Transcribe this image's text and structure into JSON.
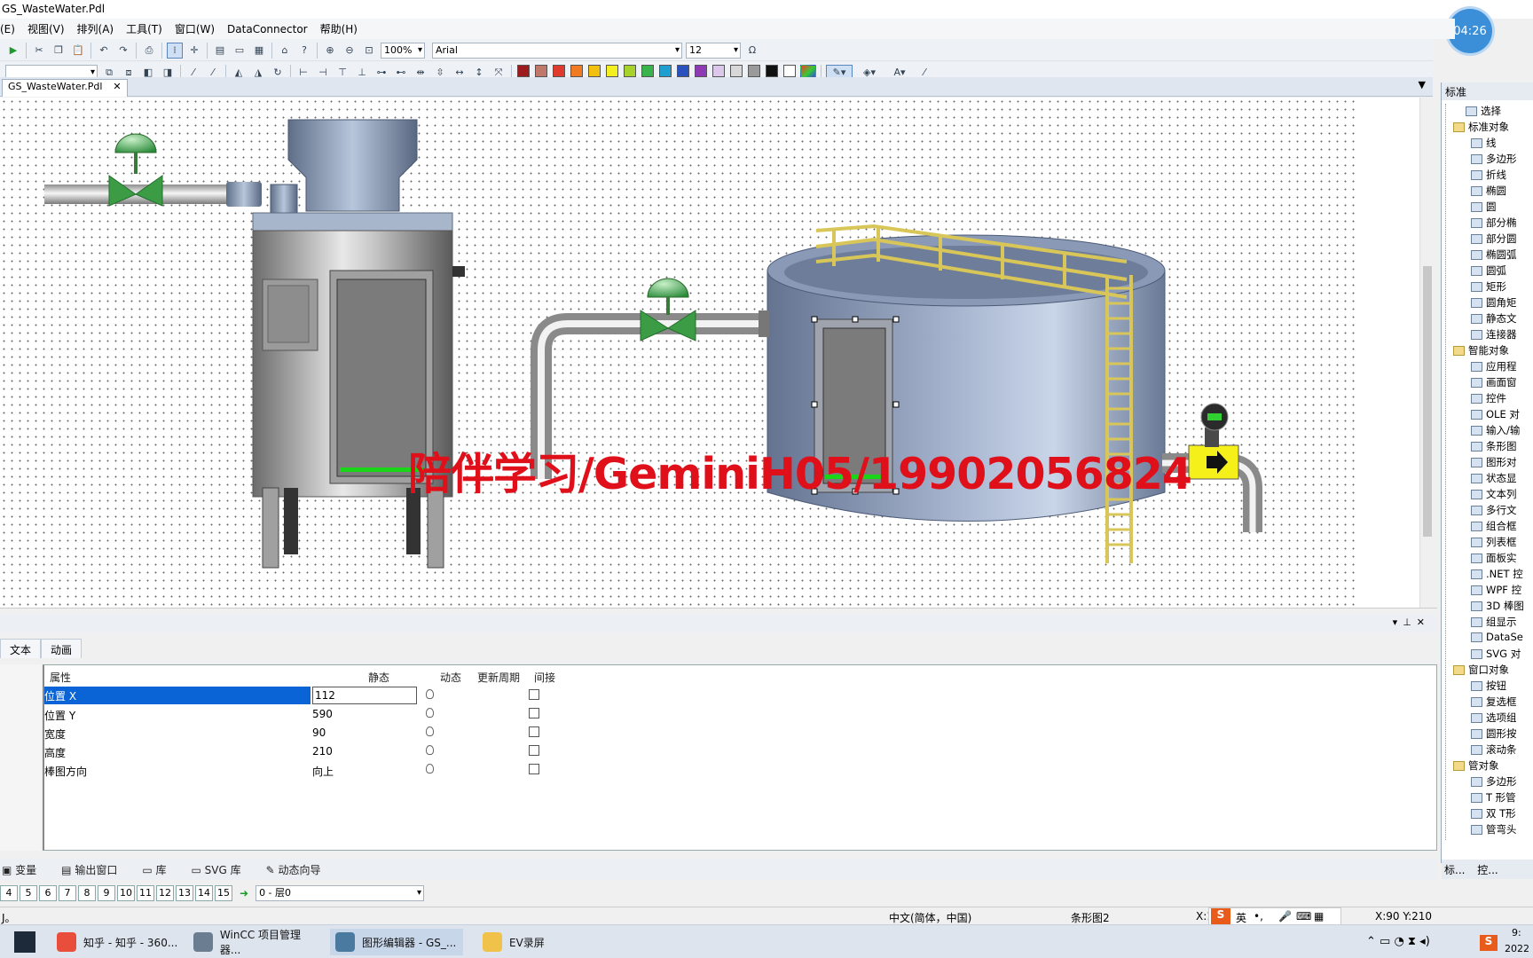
{
  "window_title": "GS_WasteWater.Pdl",
  "menu": [
    "(E)",
    "视图(V)",
    "排列(A)",
    "工具(T)",
    "窗口(W)",
    "DataConnector",
    "帮助(H)"
  ],
  "clock": "04:26",
  "toolbar": {
    "zoom": "100%",
    "font": "Arial",
    "font_size": "12",
    "omega": "Ω"
  },
  "palette_colors": [
    "#9b1b1f",
    "#c0786a",
    "#e03a2c",
    "#f07b22",
    "#f2c10f",
    "#f4ef21",
    "#a6d22b",
    "#39b44a",
    "#1e9fd0",
    "#2a52be",
    "#8e3ab5",
    "#dcc8ea",
    "#d8d8d8",
    "#9a9a9a",
    "#111111",
    "#ffffff"
  ],
  "doc_tab": {
    "label": "GS_WasteWater.Pdl",
    "close": "✕"
  },
  "watermark": "陪伴学习/GeminiH05/19902056824",
  "properties": {
    "tabs": [
      "文本",
      "动画"
    ],
    "headers": {
      "name": "属性",
      "static": "静态",
      "dynamic": "动态",
      "cycle": "更新周期",
      "indirect": "间接"
    },
    "rows": [
      {
        "name": "位置 X",
        "value": "112"
      },
      {
        "name": "位置 Y",
        "value": "590"
      },
      {
        "name": "宽度",
        "value": "90"
      },
      {
        "name": "高度",
        "value": "210"
      },
      {
        "name": "棒图方向",
        "value": "向上"
      }
    ]
  },
  "bottom_tabs": [
    "变量",
    "输出窗口",
    "库",
    "SVG 库",
    "动态向导"
  ],
  "layers": [
    "4",
    "5",
    "6",
    "7",
    "8",
    "9",
    "10",
    "11",
    "12",
    "13",
    "14",
    "15"
  ],
  "layer_select": "0 - 层0",
  "status": {
    "left": "J。",
    "lang": "中文(简体，中国)",
    "object": "条形图2",
    "pos1": "X:1",
    "pos2": "X:90 Y:210"
  },
  "ime": [
    "英",
    "•,"
  ],
  "taskbar": [
    {
      "label": "知乎 - 知乎 - 360...",
      "color": "#e94e3c"
    },
    {
      "label": "WinCC 项目管理器...",
      "color": "#6b7d90"
    },
    {
      "label": "图形编辑器 - GS_...",
      "color": "#4b7aa0"
    },
    {
      "label": "EV录屏",
      "color": "#f0c24a"
    }
  ],
  "tray_time": "9:",
  "tray_date": "2022",
  "right_panel": {
    "title": "标准",
    "items": [
      {
        "label": "选择",
        "level": 1
      },
      {
        "label": "标准对象",
        "level": 0
      },
      {
        "label": "线",
        "level": 2
      },
      {
        "label": "多边形",
        "level": 2
      },
      {
        "label": "折线",
        "level": 2
      },
      {
        "label": "椭圆",
        "level": 2
      },
      {
        "label": "圆",
        "level": 2
      },
      {
        "label": "部分椭",
        "level": 2
      },
      {
        "label": "部分圆",
        "level": 2
      },
      {
        "label": "椭圆弧",
        "level": 2
      },
      {
        "label": "圆弧",
        "level": 2
      },
      {
        "label": "矩形",
        "level": 2
      },
      {
        "label": "圆角矩",
        "level": 2
      },
      {
        "label": "静态文",
        "level": 2
      },
      {
        "label": "连接器",
        "level": 2
      },
      {
        "label": "智能对象",
        "level": 0
      },
      {
        "label": "应用程",
        "level": 2
      },
      {
        "label": "画面窗",
        "level": 2
      },
      {
        "label": "控件",
        "level": 2
      },
      {
        "label": "OLE 对",
        "level": 2
      },
      {
        "label": "输入/输",
        "level": 2
      },
      {
        "label": "条形图",
        "level": 2
      },
      {
        "label": "图形对",
        "level": 2
      },
      {
        "label": "状态显",
        "level": 2
      },
      {
        "label": "文本列",
        "level": 2
      },
      {
        "label": "多行文",
        "level": 2
      },
      {
        "label": "组合框",
        "level": 2
      },
      {
        "label": "列表框",
        "level": 2
      },
      {
        "label": "面板实",
        "level": 2
      },
      {
        "label": ".NET 控",
        "level": 2
      },
      {
        "label": "WPF 控",
        "level": 2
      },
      {
        "label": "3D 棒图",
        "level": 2
      },
      {
        "label": "组显示",
        "level": 2
      },
      {
        "label": "DataSe",
        "level": 2
      },
      {
        "label": "SVG 对",
        "level": 2
      },
      {
        "label": "窗口对象",
        "level": 0
      },
      {
        "label": "按钮",
        "level": 2
      },
      {
        "label": "复选框",
        "level": 2
      },
      {
        "label": "选项组",
        "level": 2
      },
      {
        "label": "圆形按",
        "level": 2
      },
      {
        "label": "滚动条",
        "level": 2
      },
      {
        "label": "管对象",
        "level": 0
      },
      {
        "label": "多边形",
        "level": 2
      },
      {
        "label": "T 形管",
        "level": 2
      },
      {
        "label": "双 T形",
        "level": 2
      },
      {
        "label": "管弯头",
        "level": 2
      }
    ],
    "tabs": [
      "标...",
      "控..."
    ]
  }
}
